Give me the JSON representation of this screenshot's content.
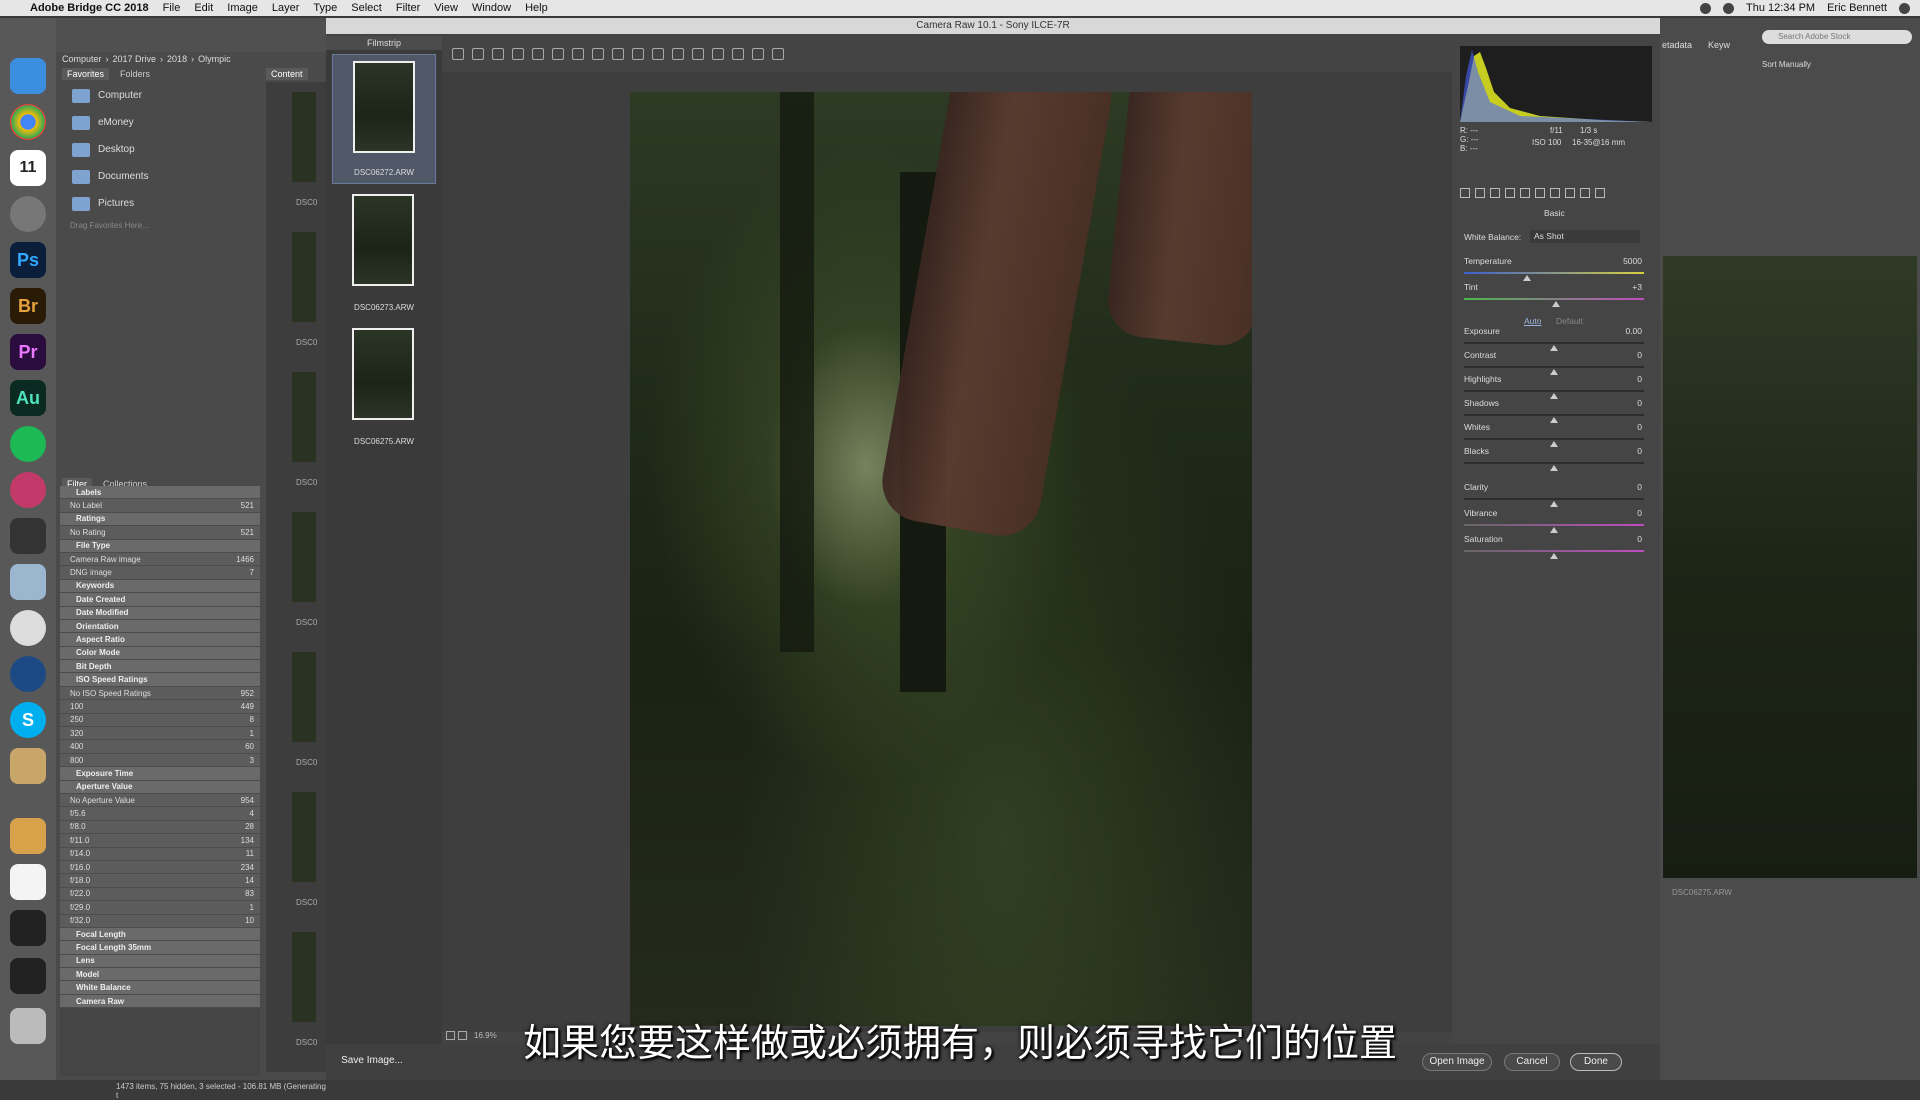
{
  "menubar": {
    "app": "Adobe Bridge CC 2018",
    "items": [
      "File",
      "Edit",
      "Image",
      "Layer",
      "Type",
      "Select",
      "Filter",
      "View",
      "Window",
      "Help"
    ],
    "time": "Thu 12:34 PM",
    "user": "Eric Bennett"
  },
  "bridge": {
    "path": [
      "Computer",
      "2017 Drive",
      "2018",
      "Olympic"
    ],
    "tabs": {
      "favorites": "Favorites",
      "folders": "Folders",
      "content": "Content"
    },
    "favorites": [
      "Computer",
      "eMoney",
      "Desktop",
      "Documents",
      "Pictures"
    ],
    "fav_hint": "Drag Favorites Here...",
    "filter_tabs": {
      "filter": "Filter",
      "collections": "Collections"
    },
    "filter_rows": [
      {
        "label": "Labels",
        "count": "",
        "hdr": true
      },
      {
        "label": "No Label",
        "count": "521",
        "hdr": false
      },
      {
        "label": "Ratings",
        "count": "",
        "hdr": true
      },
      {
        "label": "No Rating",
        "count": "521",
        "hdr": false
      },
      {
        "label": "File Type",
        "count": "",
        "hdr": true
      },
      {
        "label": "Camera Raw image",
        "count": "1466",
        "hdr": false
      },
      {
        "label": "DNG image",
        "count": "7",
        "hdr": false
      },
      {
        "label": "Keywords",
        "count": "",
        "hdr": true
      },
      {
        "label": "Date Created",
        "count": "",
        "hdr": true
      },
      {
        "label": "Date Modified",
        "count": "",
        "hdr": true
      },
      {
        "label": "Orientation",
        "count": "",
        "hdr": true
      },
      {
        "label": "Aspect Ratio",
        "count": "",
        "hdr": true
      },
      {
        "label": "Color Mode",
        "count": "",
        "hdr": true
      },
      {
        "label": "Bit Depth",
        "count": "",
        "hdr": true
      },
      {
        "label": "ISO Speed Ratings",
        "count": "",
        "hdr": true
      },
      {
        "label": "No ISO Speed Ratings",
        "count": "952",
        "hdr": false
      },
      {
        "label": "100",
        "count": "449",
        "hdr": false
      },
      {
        "label": "250",
        "count": "8",
        "hdr": false
      },
      {
        "label": "320",
        "count": "1",
        "hdr": false
      },
      {
        "label": "400",
        "count": "60",
        "hdr": false
      },
      {
        "label": "800",
        "count": "3",
        "hdr": false
      },
      {
        "label": "Exposure Time",
        "count": "",
        "hdr": true
      },
      {
        "label": "Aperture Value",
        "count": "",
        "hdr": true
      },
      {
        "label": "No Aperture Value",
        "count": "954",
        "hdr": false
      },
      {
        "label": "f/5.6",
        "count": "4",
        "hdr": false
      },
      {
        "label": "f/8.0",
        "count": "28",
        "hdr": false
      },
      {
        "label": "f/11.0",
        "count": "134",
        "hdr": false
      },
      {
        "label": "f/14.0",
        "count": "11",
        "hdr": false
      },
      {
        "label": "f/16.0",
        "count": "234",
        "hdr": false
      },
      {
        "label": "f/18.0",
        "count": "14",
        "hdr": false
      },
      {
        "label": "f/22.0",
        "count": "83",
        "hdr": false
      },
      {
        "label": "f/29.0",
        "count": "1",
        "hdr": false
      },
      {
        "label": "f/32.0",
        "count": "10",
        "hdr": false
      },
      {
        "label": "Focal Length",
        "count": "",
        "hdr": true
      },
      {
        "label": "Focal Length 35mm",
        "count": "",
        "hdr": true
      },
      {
        "label": "Lens",
        "count": "",
        "hdr": true
      },
      {
        "label": "Model",
        "count": "",
        "hdr": true
      },
      {
        "label": "White Balance",
        "count": "",
        "hdr": true
      },
      {
        "label": "Camera Raw",
        "count": "",
        "hdr": true
      }
    ],
    "content_labels": [
      "DSC0",
      "DSC0",
      "DSC0",
      "DSC0",
      "DSC0",
      "DSC0",
      "DSC0"
    ],
    "status": "1473 items, 75 hidden, 3 selected - 106.81 MB (Generating t",
    "right_tabs": {
      "metadata": "etadata",
      "keywords": "Keyw"
    },
    "search_placeholder": "Search Adobe Stock",
    "sort": "Sort Manually",
    "preview_name": "DSC06275.ARW"
  },
  "acr": {
    "title": "Camera Raw 10.1 - Sony ILCE-7R",
    "filmstrip_title": "Filmstrip",
    "filmstrip": [
      {
        "name": "DSC06272.ARW",
        "selected": true
      },
      {
        "name": "DSC06273.ARW",
        "selected": false
      },
      {
        "name": "DSC06275.ARW",
        "selected": false
      }
    ],
    "zoom": "16.9%",
    "buttons": {
      "save": "Save Image...",
      "open": "Open Image",
      "cancel": "Cancel",
      "done": "Done"
    },
    "histogram": {
      "r": "R:  ---",
      "g": "G:  ---",
      "b": "B:  ---",
      "aperture": "f/11",
      "shutter": "1/3 s",
      "iso": "ISO 100",
      "lens": "16-35@16 mm"
    },
    "panel_title": "Basic",
    "white_balance": {
      "label": "White Balance:",
      "value": "As Shot"
    },
    "auto": "Auto",
    "default": "Default",
    "sliders": [
      {
        "label": "Temperature",
        "value": "5000",
        "pos": 0.35
      },
      {
        "label": "Tint",
        "value": "+3",
        "pos": 0.51
      },
      {
        "label": "Exposure",
        "value": "0.00",
        "pos": 0.5
      },
      {
        "label": "Contrast",
        "value": "0",
        "pos": 0.5
      },
      {
        "label": "Highlights",
        "value": "0",
        "pos": 0.5
      },
      {
        "label": "Shadows",
        "value": "0",
        "pos": 0.5
      },
      {
        "label": "Whites",
        "value": "0",
        "pos": 0.5
      },
      {
        "label": "Blacks",
        "value": "0",
        "pos": 0.5
      },
      {
        "label": "Clarity",
        "value": "0",
        "pos": 0.5
      },
      {
        "label": "Vibrance",
        "value": "0",
        "pos": 0.5
      },
      {
        "label": "Saturation",
        "value": "0",
        "pos": 0.5
      }
    ]
  },
  "subtitle": "如果您要这样做或必须拥有，则必须寻找它们的位置",
  "colors": {
    "accent": "#5a6a8a",
    "panel": "#454545",
    "chrome": "#3a3a3a"
  }
}
